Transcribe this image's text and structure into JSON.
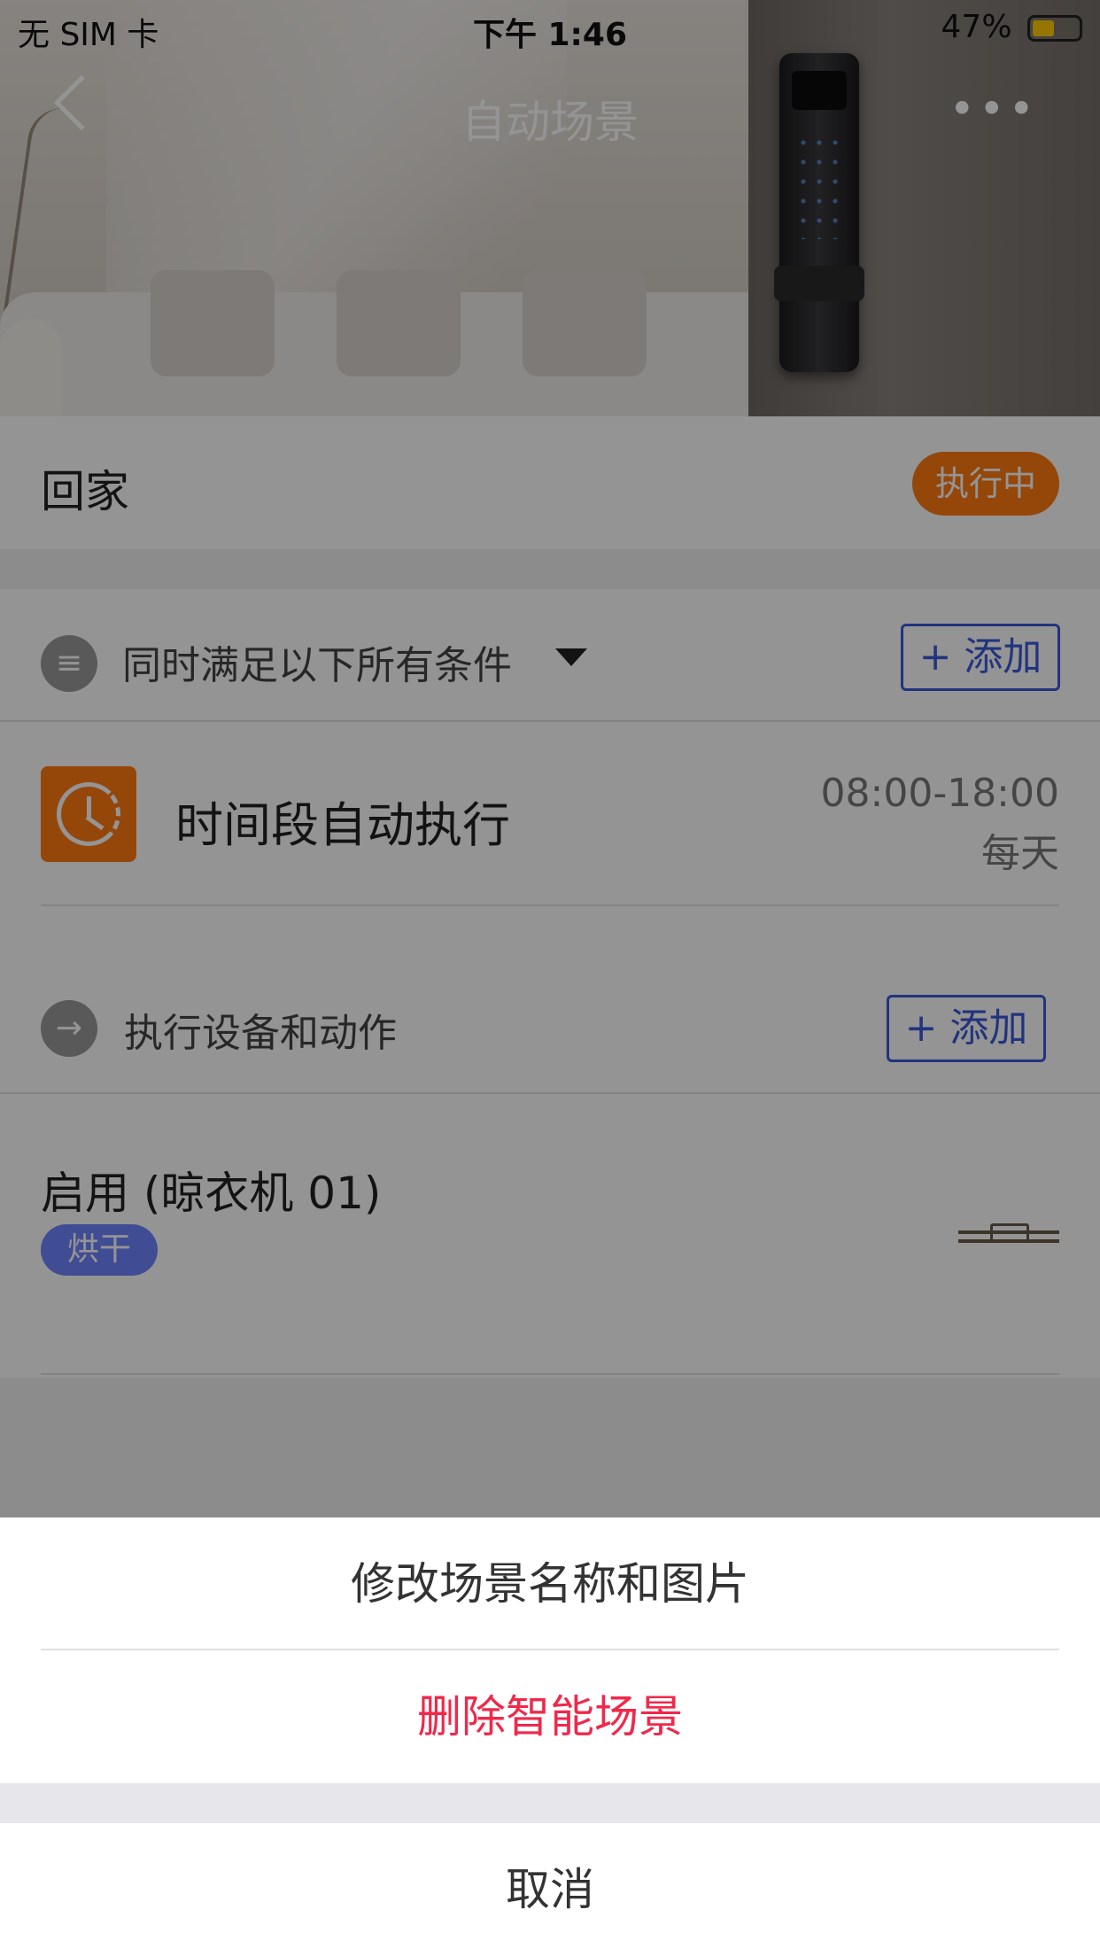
{
  "status_bar": {
    "carrier": "无 SIM 卡",
    "time": "下午 1:46",
    "battery": "47%"
  },
  "nav": {
    "title": "自动场景"
  },
  "scene": {
    "name": "回家",
    "status_badge": "执行中"
  },
  "conditions": {
    "header": "同时满足以下所有条件",
    "add_label": "+ 添加",
    "items": [
      {
        "title": "时间段自动执行",
        "time_range": "08:00-18:00",
        "repeat": "每天"
      }
    ]
  },
  "actions": {
    "header": "执行设备和动作",
    "add_label": "+ 添加",
    "items": [
      {
        "title": "启用 (晾衣机 01)",
        "tag": "烘干"
      }
    ]
  },
  "action_sheet": {
    "options": [
      "修改场景名称和图片",
      "删除智能场景"
    ],
    "cancel": "取消"
  },
  "colors": {
    "accent_orange": "#ff7a10",
    "accent_blue": "#3b5bd9",
    "destructive": "#f0284a",
    "tag_blue": "#6f83ff"
  }
}
